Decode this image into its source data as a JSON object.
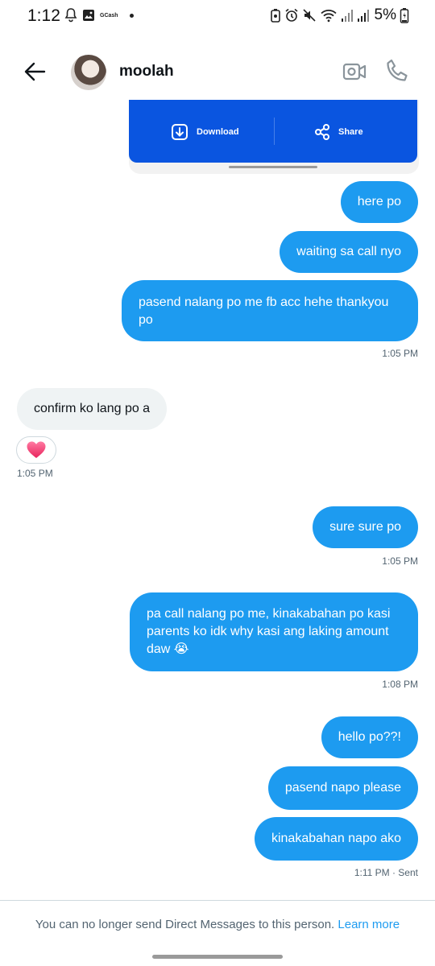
{
  "status_bar": {
    "time": "1:12",
    "app_label": "GCash",
    "battery": "5%"
  },
  "header": {
    "title": "moolah"
  },
  "share_card": {
    "download_label": "Download",
    "share_label": "Share",
    "accent": "#0a55e0"
  },
  "messages": [
    {
      "side": "out",
      "text": "here po"
    },
    {
      "side": "out",
      "text": "waiting sa call nyo"
    },
    {
      "side": "out",
      "text": "pasend nalang po me fb acc hehe thankyou po"
    },
    {
      "side": "ts",
      "text": "1:05 PM"
    },
    {
      "side": "in",
      "text": "confirm ko lang po a"
    },
    {
      "side": "reaction",
      "text": "heart"
    },
    {
      "side": "ts",
      "text": "1:05 PM"
    },
    {
      "side": "out",
      "text": "sure sure po"
    },
    {
      "side": "ts",
      "text": "1:05 PM"
    },
    {
      "side": "out",
      "text": "pa call nalang po me, kinakabahan po kasi parents ko idk why kasi ang laking amount daw 😭"
    },
    {
      "side": "ts",
      "text": "1:08 PM"
    },
    {
      "side": "out",
      "text": "hello po??!"
    },
    {
      "side": "out",
      "text": "pasend napo please"
    },
    {
      "side": "out",
      "text": "kinakabahan napo ako"
    },
    {
      "side": "ts",
      "text": "1:11 PM · Sent"
    }
  ],
  "footer": {
    "notice": "You can no longer send Direct Messages to this person.",
    "link": "Learn more"
  },
  "colors": {
    "outgoing_bubble": "#1d9bf0",
    "incoming_bubble": "#eff3f4",
    "link": "#1d9bf0"
  }
}
